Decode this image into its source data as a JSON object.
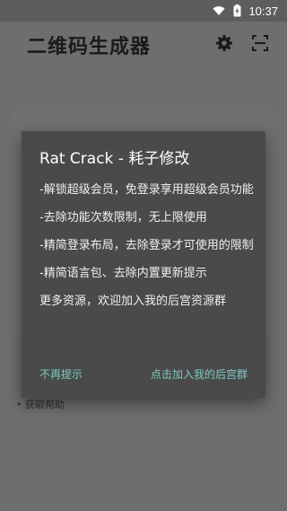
{
  "status_bar": {
    "time": "10:37",
    "icons": [
      "wifi-icon",
      "battery-icon"
    ]
  },
  "app_bar": {
    "title": "二维码生成器",
    "icons": [
      "gear-icon",
      "scan-icon"
    ]
  },
  "background": {
    "help_text": "• 获取帮助"
  },
  "dialog": {
    "title": "Rat Crack - 耗子修改",
    "lines": [
      "-解锁超级会员，免登录享用超级会员功能",
      "-去除功能次数限制，无上限使用",
      "-精简登录布局，去除登录才可使用的限制",
      "-精简语言包、去除内置更新提示",
      "更多资源，欢迎加入我的后宫资源群"
    ],
    "negative_button": "不再提示",
    "positive_button": "点击加入我的后宫群"
  },
  "colors": {
    "accent": "#7fc8c0",
    "dialog_bg": "#4a4a4a",
    "scrim": "#6e6e6e"
  }
}
